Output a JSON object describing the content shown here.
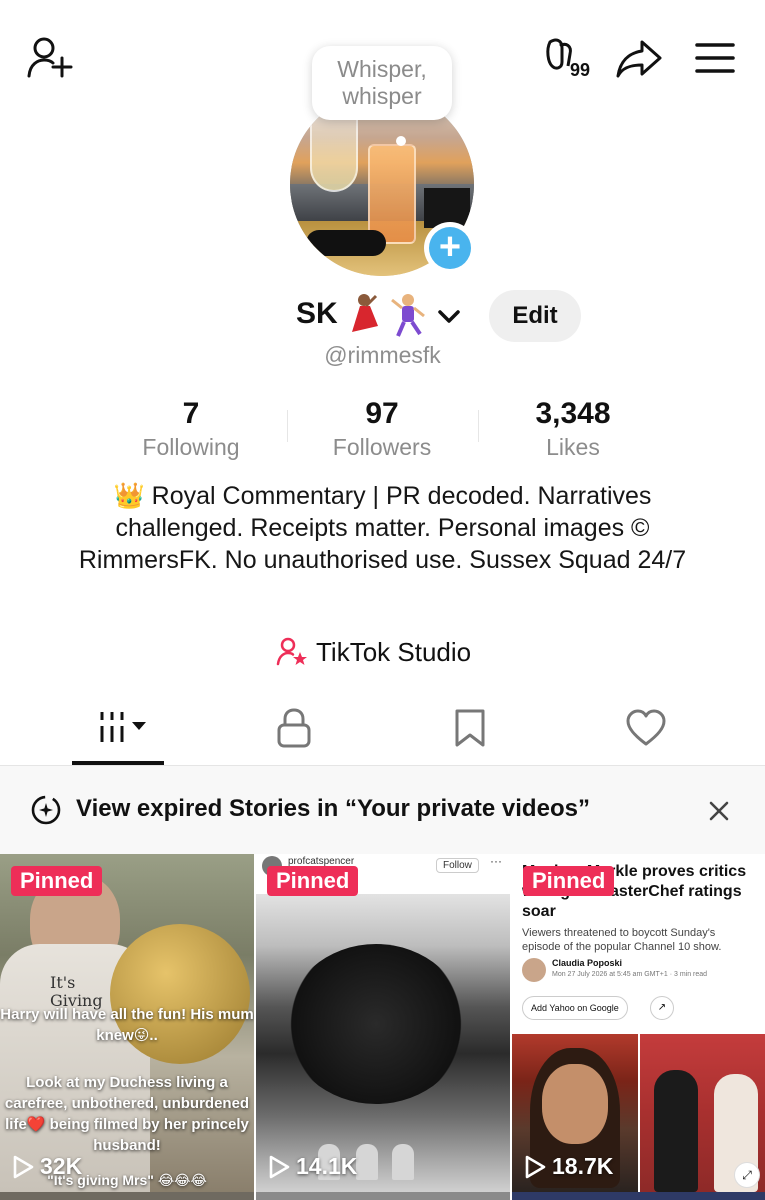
{
  "header": {
    "icons": [
      "add-friend-icon",
      "now-icon",
      "share-icon",
      "menu-icon"
    ],
    "now_badge": "99"
  },
  "profile": {
    "bubble_text": "Whisper,\nwhisper",
    "display_name": "SK",
    "edit_label": "Edit",
    "handle": "@rimmesfk"
  },
  "stats": [
    {
      "value": "7",
      "label": "Following"
    },
    {
      "value": "97",
      "label": "Followers"
    },
    {
      "value": "3,348",
      "label": "Likes"
    }
  ],
  "bio": "👑 Royal Commentary | PR decoded. Narratives challenged. Receipts matter. Personal images © RimmersFK. No unauthorised use. Sussex Squad 24/7",
  "studio": {
    "label": "TikTok Studio"
  },
  "tabs": [
    "videos",
    "private",
    "favorites",
    "liked"
  ],
  "banner": {
    "text": "View expired Stories in “Your private videos”"
  },
  "videos": [
    {
      "badge": "Pinned",
      "views": "32K",
      "shirt_text": "It's\nGiving",
      "caption_1": "Harry will have all the fun! His mum knew😜..",
      "caption_2": "Look at my Duchess living a carefree, unbothered, unburdened life❤️ being filmed by her princely husband!",
      "caption_3": "\"It's giving Mrs\" 😂😂😂"
    },
    {
      "badge": "Pinned",
      "views": "14.1K",
      "post_user": "profcatspencer",
      "follow_label": "Follow",
      "more_label": "···"
    },
    {
      "badge": "Pinned",
      "views": "18.7K",
      "headline": "Meghan Markle proves critics wrong as MasterChef ratings soar",
      "subhead": "Viewers threatened to boycott Sunday's episode of the popular Channel 10 show.",
      "author": "Claudia Poposki",
      "date": "Mon 27 July 2026 at 5:45 am GMT+1 · 3 min read",
      "yahoo_label": "Add Yahoo on Google"
    }
  ]
}
